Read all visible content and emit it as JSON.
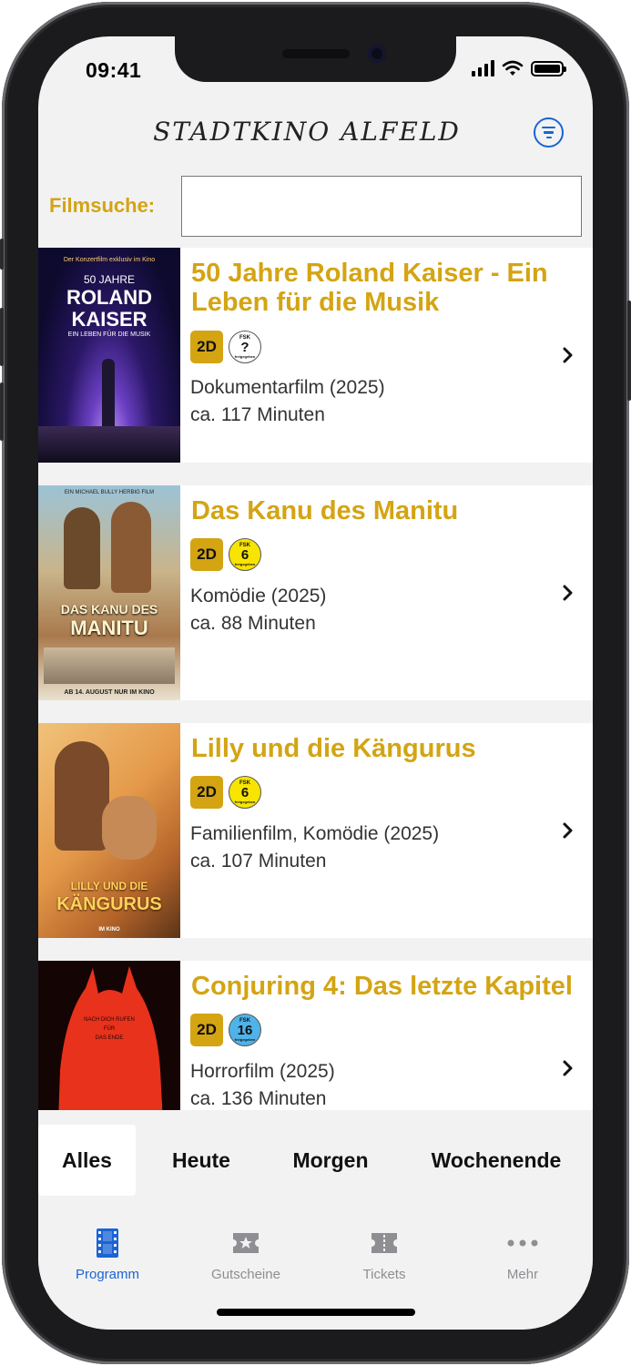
{
  "status_bar": {
    "time": "09:41",
    "icons": [
      "signal-icon",
      "wifi-icon",
      "battery-icon"
    ]
  },
  "header": {
    "title": "STADTKINO ALFELD",
    "filter_icon": "filter-icon"
  },
  "search": {
    "label": "Filmsuche:",
    "value": "",
    "placeholder": ""
  },
  "films": [
    {
      "title": "50 Jahre Roland Kaiser - Ein Leben für die Musik",
      "format": "2D",
      "fsk": {
        "top": "FSK",
        "value": "?",
        "bottom": "freigegeben"
      },
      "genre": "Dokumentarfilm (2025)",
      "duration": "ca. 117 Minuten",
      "poster": {
        "tagline": "Der Konzertfilm exklusiv im Kino",
        "line1": "50 JAHRE",
        "line2": "ROLAND",
        "line3": "KAISER",
        "line4": "EIN LEBEN FÜR DIE MUSIK"
      }
    },
    {
      "title": "Das Kanu des Manitu",
      "format": "2D",
      "fsk": {
        "top": "FSK",
        "value": "6",
        "bottom": "freigegeben"
      },
      "genre": "Komödie (2025)",
      "duration": "ca. 88 Minuten",
      "poster": {
        "tagline": "EIN MICHAEL BULLY HERBIG FILM",
        "line1": "DAS KANU DES",
        "line2": "MANITU",
        "line3": "AB 14. AUGUST NUR IM KINO"
      }
    },
    {
      "title": "Lilly und die Kängurus",
      "format": "2D",
      "fsk": {
        "top": "FSK",
        "value": "6",
        "bottom": "freigegeben"
      },
      "genre": "Familienfilm, Komödie (2025)",
      "duration": "ca. 107 Minuten",
      "poster": {
        "line1": "LILLY UND DIE",
        "line2": "KÄNGURUS",
        "line3": "IM KINO"
      }
    },
    {
      "title": "Conjuring 4: Das letzte Kapitel",
      "format": "2D",
      "fsk": {
        "top": "FSK",
        "value": "16",
        "bottom": "freigegeben"
      },
      "genre": "Horrorfilm (2025)",
      "duration": "ca. 136 Minuten",
      "poster": {
        "line1": "NACH DICH RUFEN",
        "line2": "FÜR",
        "line3": "DAS ENDE"
      }
    }
  ],
  "date_filter": {
    "tabs": [
      "Alles",
      "Heute",
      "Morgen",
      "Wochenende"
    ],
    "active": "Alles"
  },
  "tab_bar": {
    "items": [
      {
        "label": "Programm",
        "icon": "film-icon",
        "active": true
      },
      {
        "label": "Gutscheine",
        "icon": "voucher-icon",
        "active": false
      },
      {
        "label": "Tickets",
        "icon": "ticket-icon",
        "active": false
      },
      {
        "label": "Mehr",
        "icon": "more-icon",
        "active": false
      }
    ]
  },
  "colors": {
    "accent": "#d4a413",
    "tab_active": "#1a64d6",
    "fsk6": "#f7e400",
    "fsk16": "#4fb3e8",
    "fsk_unknown": "#ffffff"
  }
}
